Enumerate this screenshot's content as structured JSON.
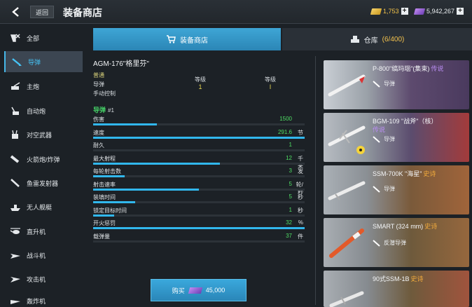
{
  "topbar": {
    "back_label": "返回",
    "title": "装备商店",
    "gold": "1,753",
    "gems": "5,942,267"
  },
  "sidebar": {
    "items": [
      {
        "label": "全部",
        "icon": "all-icon"
      },
      {
        "label": "导弹",
        "icon": "missile-icon",
        "active": true
      },
      {
        "label": "主炮",
        "icon": "main-gun-icon"
      },
      {
        "label": "自动炮",
        "icon": "autocannon-icon"
      },
      {
        "label": "对空武器",
        "icon": "anti-air-icon"
      },
      {
        "label": "火箭炮/炸弹",
        "icon": "rocket-icon"
      },
      {
        "label": "鱼雷发射器",
        "icon": "torpedo-icon"
      },
      {
        "label": "无人舰艇",
        "icon": "drone-ship-icon"
      },
      {
        "label": "直升机",
        "icon": "helicopter-icon"
      },
      {
        "label": "战斗机",
        "icon": "fighter-icon"
      },
      {
        "label": "攻击机",
        "icon": "attack-aircraft-icon"
      },
      {
        "label": "轰炸机",
        "icon": "bomber-icon"
      }
    ]
  },
  "tabs": {
    "shop": "装备商店",
    "warehouse": "仓库",
    "warehouse_count": "(6/400)"
  },
  "detail": {
    "name": "AGM-176\"格里芬\"",
    "rarity": "普通",
    "type": "导弹",
    "control": "手动控制",
    "level_label_1": "等级",
    "level_value_1": "1",
    "level_label_2": "等级",
    "level_value_2": "I",
    "slot_label": "导弹",
    "slot_number": "#1",
    "stats": [
      {
        "name": "伤害",
        "value": "1500",
        "unit": "",
        "fill": 0.3
      },
      {
        "name": "速度",
        "value": "291.6",
        "unit": "节",
        "fill": 1.0
      },
      {
        "name": "耐久",
        "value": "1",
        "unit": "",
        "fill": 0.0
      },
      {
        "name": "最大射程",
        "value": "12",
        "unit": "千米",
        "fill": 0.6
      },
      {
        "name": "每轮射击数",
        "value": "3",
        "unit": "发",
        "fill": 0.15
      },
      {
        "name": "射击速率",
        "value": "5",
        "unit": "轮/秒",
        "fill": 0.5
      },
      {
        "name": "装填时间",
        "value": "5",
        "unit": "秒",
        "fill": 0.2
      },
      {
        "name": "锁定目标时间",
        "value": "1",
        "unit": "秒",
        "fill": 0.1
      },
      {
        "name": "开火惩罚",
        "value": "32",
        "unit": "%",
        "fill": 1.0
      },
      {
        "name": "载弹量",
        "value": "37",
        "unit": "件",
        "fill": 0.0
      }
    ],
    "buy_label": "购买",
    "buy_price": "45,000"
  },
  "cards": [
    {
      "name": "P-800\"缟玛瑙\"(集束)",
      "rarity": "传说",
      "type": "导弹"
    },
    {
      "name": "BGM-109 \"战斧\"（核）",
      "rarity": "传说",
      "type": "导弹"
    },
    {
      "name": "SSM-700K \"海星\"",
      "rarity": "史诗",
      "type": "导弹"
    },
    {
      "name": "SMART (324 mm)",
      "rarity": "史诗",
      "type": "反潜导弹"
    },
    {
      "name": "90式SSM-1B",
      "rarity": "史诗",
      "type": ""
    }
  ],
  "colors": {
    "accent": "#31b7ec",
    "stat_value": "#4fdf64",
    "legendary": "#b98cf2",
    "epic": "#f0a93c"
  }
}
